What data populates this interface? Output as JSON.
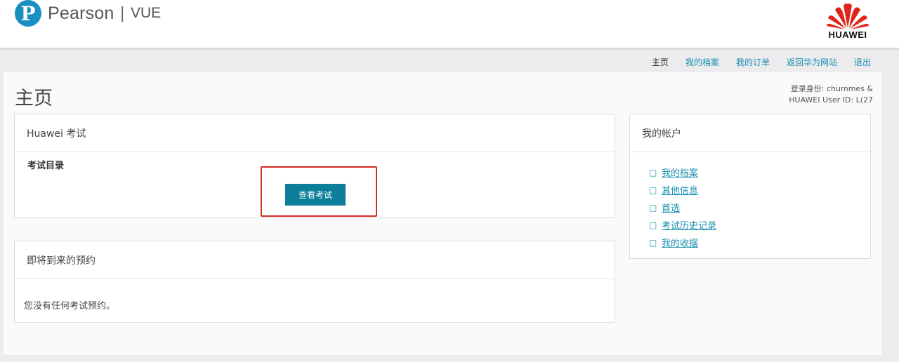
{
  "header": {
    "logo_letter": "P",
    "brand": "Pearson",
    "separator": "|",
    "product": "VUE",
    "partner": "HUAWEI",
    "partner_color": "#e1251b"
  },
  "nav": {
    "items": [
      {
        "label": "主页",
        "active": true
      },
      {
        "label": "我的档案",
        "active": false
      },
      {
        "label": "我的订单",
        "active": false
      },
      {
        "label": "返回华为网站",
        "active": false
      },
      {
        "label": "退出",
        "active": false
      }
    ]
  },
  "page": {
    "title": "主页",
    "login_label": "登录身份: chummes &",
    "user_id": "HUAWEI User ID: L(27"
  },
  "exam_card": {
    "title": "Huawei 考试",
    "catalog_label": "考试目录",
    "view_button": "查看考试"
  },
  "upcoming_card": {
    "title": "即将到来的预约",
    "empty_text": "您没有任何考试预约。"
  },
  "account_card": {
    "title": "我的帐户",
    "bullet": "□",
    "links": [
      {
        "label": "我的档案"
      },
      {
        "label": "其他信息"
      },
      {
        "label": "首选"
      },
      {
        "label": "考试历史记录"
      },
      {
        "label": "我的收据"
      }
    ]
  },
  "colors": {
    "accent": "#1a8fb0",
    "button": "#0e7f9a",
    "highlight": "#d32b26"
  }
}
